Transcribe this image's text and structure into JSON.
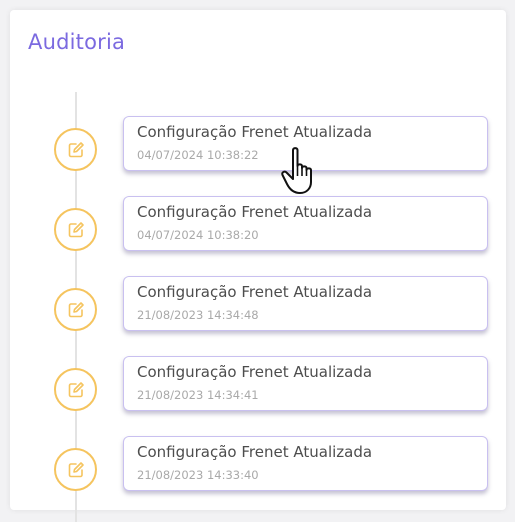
{
  "panel": {
    "title": "Auditoria"
  },
  "timeline": {
    "entries": [
      {
        "title": "Configuração Frenet Atualizada",
        "timestamp": "04/07/2024 10:38:22",
        "icon": "edit-icon"
      },
      {
        "title": "Configuração Frenet Atualizada",
        "timestamp": "04/07/2024 10:38:20",
        "icon": "edit-icon"
      },
      {
        "title": "Configuração Frenet Atualizada",
        "timestamp": "21/08/2023 14:34:48",
        "icon": "edit-icon"
      },
      {
        "title": "Configuração Frenet Atualizada",
        "timestamp": "21/08/2023 14:34:41",
        "icon": "edit-icon"
      },
      {
        "title": "Configuração Frenet Atualizada",
        "timestamp": "21/08/2023 14:33:40",
        "icon": "edit-icon"
      }
    ]
  },
  "colors": {
    "title": "#7b6ae0",
    "icon_ring": "#f5c45e",
    "entry_border": "#c9c0f0",
    "timeline_line": "#e3e3e3"
  }
}
